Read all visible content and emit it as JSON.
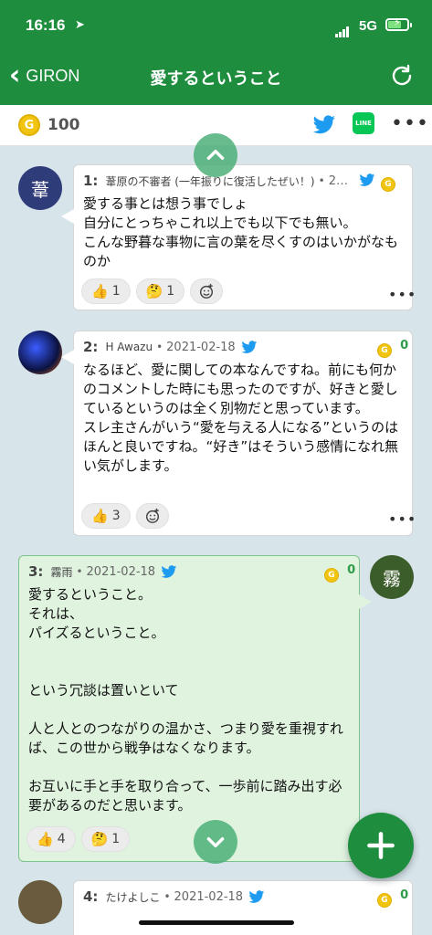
{
  "status_bar": {
    "time": "16:16",
    "location_icon": "location-arrow-icon",
    "network": "5G"
  },
  "nav": {
    "back_label": "GIRON",
    "title": "愛するということ",
    "reload_icon": "reload-icon"
  },
  "toolbar": {
    "coin_symbol": "G",
    "coin_count": "100",
    "twitter_icon": "twitter-icon",
    "line_label": "LINE",
    "more_label": "•••"
  },
  "colors": {
    "brand": "#1e8e3e",
    "coin": "#f1c40f",
    "twitter": "#1d9bf0",
    "line": "#06c755"
  },
  "posts": [
    {
      "number": "1:",
      "author": "葦原の不審者 (一年振りに復活したぜい！)",
      "date": "2…",
      "avatar_char": "葦",
      "coin_count": "",
      "text": "愛する事とは想う事でしょ\n自分にとっちゃこれ以上でも以下でも無い。\nこんな野暮な事物に言の葉を尽くすのはいかがなものか",
      "reactions": [
        {
          "emoji": "👍",
          "count": "1"
        },
        {
          "emoji": "🤔",
          "count": "1"
        }
      ],
      "more": "•••"
    },
    {
      "number": "2:",
      "author": "H Awazu",
      "date": "2021-02-18",
      "avatar_char": "",
      "coin_count": "0",
      "text": "なるほど、愛に関しての本なんですね。前にも何かのコメントした時にも思ったのですが、好きと愛しているというのは全く別物だと思っています。\nスレ主さんがいう“愛を与える人になる”というのはほんと良いですね。“好き”はそういう感情になれ無い気がします。",
      "reactions": [
        {
          "emoji": "👍",
          "count": "3"
        }
      ],
      "more": "•••"
    },
    {
      "number": "3:",
      "author": "霧雨",
      "date": "2021-02-18",
      "avatar_char": "霧",
      "coin_count": "0",
      "text": "愛するということ。\nそれは、\nパイズるということ。\n\n\nという冗談は置いといて\n\n人と人とのつながりの温かさ、つまり愛を重視すれば、この世から戦争はなくなります。\n\nお互いに手と手を取り合って、一歩前に踏み出す必要があるのだと思います。",
      "reactions": [
        {
          "emoji": "👍",
          "count": "4"
        },
        {
          "emoji": "🤔",
          "count": "1"
        }
      ]
    },
    {
      "number": "4:",
      "author": "たけよしこ",
      "date": "2021-02-18",
      "coin_count": "0"
    }
  ],
  "fab_label": "+"
}
